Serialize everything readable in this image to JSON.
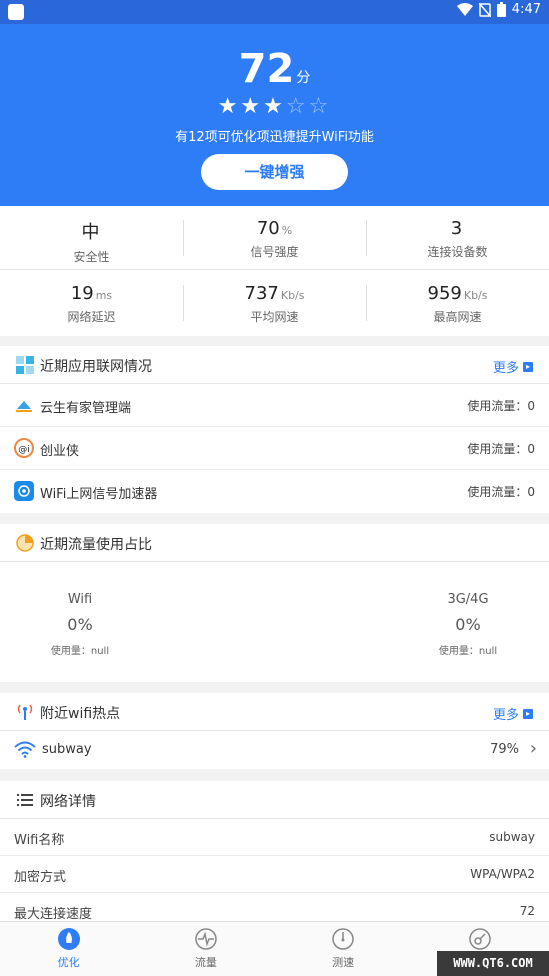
{
  "status_bar": {
    "time": "4:47"
  },
  "hero": {
    "score": "72",
    "score_unit": "分",
    "stars_on": "★★★",
    "stars_off": "☆☆",
    "tip": "有12项可优化项迅捷提升WiFi功能",
    "button_label": "一键增强",
    "bg_color": "#2e7cf6"
  },
  "stats": {
    "row1": [
      {
        "value": "中",
        "unit": "",
        "label": "安全性"
      },
      {
        "value": "70",
        "unit": "%",
        "label": "信号强度"
      },
      {
        "value": "3",
        "unit": "",
        "label": "连接设备数"
      }
    ],
    "row2": [
      {
        "value": "19",
        "unit": "ms",
        "label": "网络延迟"
      },
      {
        "value": "737",
        "unit": "Kb/s",
        "label": "平均网速"
      },
      {
        "value": "959",
        "unit": "Kb/s",
        "label": "最高网速"
      }
    ]
  },
  "apps": {
    "title": "近期应用联网情况",
    "more": "更多",
    "items": [
      {
        "name": "云生有家管理端",
        "usage": "使用流量：0",
        "icon": "cloud-app-icon"
      },
      {
        "name": "创业侠",
        "usage": "使用流量：0",
        "icon": "chuangyexia-app-icon"
      },
      {
        "name": "WiFi上网信号加速器",
        "usage": "使用流量：0",
        "icon": "wifi-booster-app-icon"
      }
    ]
  },
  "traffic": {
    "title": "近期流量使用占比",
    "cols": [
      {
        "name": "Wifi",
        "percent": "0%",
        "usage": "使用量：null"
      },
      {
        "name": "3G/4G",
        "percent": "0%",
        "usage": "使用量：null"
      }
    ]
  },
  "hotspots": {
    "title": "附近wifi热点",
    "more": "更多",
    "items": [
      {
        "ssid": "subway",
        "signal": "79%"
      }
    ]
  },
  "details": {
    "title": "网络详情",
    "rows": [
      {
        "label": "Wifi名称",
        "value": "subway"
      },
      {
        "label": "加密方式",
        "value": "WPA/WPA2"
      },
      {
        "label": "最大连接速度",
        "value": "72"
      }
    ]
  },
  "tabs": [
    {
      "label": "优化",
      "active": true
    },
    {
      "label": "流量",
      "active": false
    },
    {
      "label": "测速",
      "active": false
    },
    {
      "label": "",
      "active": false
    }
  ],
  "watermark": "WWW.QT6.COM"
}
